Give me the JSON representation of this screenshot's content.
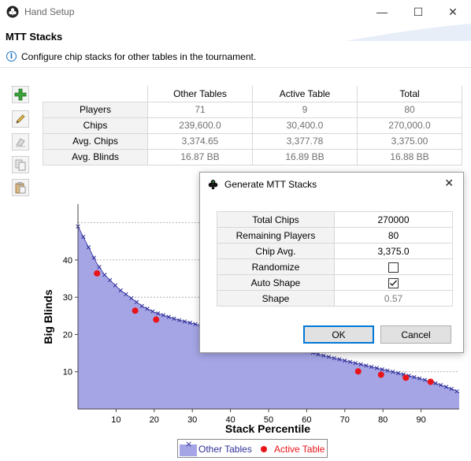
{
  "window": {
    "title": "Hand Setup",
    "minimize_glyph": "—",
    "maximize_glyph": "☐",
    "close_glyph": "✕"
  },
  "header": {
    "title": "MTT Stacks",
    "info_icon_glyph": "i",
    "info_text": "Configure chip stacks for other tables in the tournament."
  },
  "toolbar": {
    "icons": [
      "add-icon",
      "edit-icon",
      "clear-icon",
      "copy-icon",
      "paste-icon"
    ]
  },
  "stats_table": {
    "columns": [
      "Other Tables",
      "Active Table",
      "Total"
    ],
    "rows": [
      {
        "label": "Players",
        "values": [
          "71",
          "9",
          "80"
        ]
      },
      {
        "label": "Chips",
        "values": [
          "239,600.0",
          "30,400.0",
          "270,000.0"
        ]
      },
      {
        "label": "Avg. Chips",
        "values": [
          "3,374.65",
          "3,377.78",
          "3,375.00"
        ]
      },
      {
        "label": "Avg. Blinds",
        "values": [
          "16.87 BB",
          "16.89 BB",
          "16.88 BB"
        ]
      }
    ]
  },
  "chart_data": {
    "type": "area",
    "xlabel": "Stack Percentile",
    "ylabel": "Big Blinds",
    "xlim": [
      0,
      100
    ],
    "ylim": [
      0,
      55
    ],
    "xticks": [
      10,
      20,
      30,
      40,
      50,
      60,
      70,
      80,
      90
    ],
    "yticks": [
      10,
      20,
      30,
      40
    ],
    "grid": "horizontal-dashed",
    "legend_position": "bottom-center",
    "colors": {
      "other_fill": "#a5a5e6",
      "other_marker": "#2f2f9a",
      "active": "#e8141a"
    },
    "series": [
      {
        "name": "Other Tables",
        "style": "area-with-x-markers",
        "x": [
          0,
          1.5,
          3,
          5,
          7,
          9,
          11,
          13,
          15,
          17,
          20,
          23,
          26,
          30,
          35,
          40,
          45,
          50,
          55,
          60,
          65,
          70,
          75,
          80,
          85,
          90,
          93,
          95,
          97,
          99,
          100
        ],
        "y": [
          49,
          46,
          43,
          39,
          36,
          34,
          32,
          30.5,
          29,
          27.5,
          26,
          25,
          24,
          23,
          21.7,
          20.3,
          19.1,
          18,
          16.8,
          15.5,
          14.2,
          13,
          11.8,
          10.6,
          9.4,
          8.1,
          7.2,
          6.5,
          5.8,
          5,
          4.4
        ]
      },
      {
        "name": "Active Table",
        "style": "dots",
        "x": [
          5,
          15,
          20.5,
          73.5,
          79.5,
          86,
          92.5
        ],
        "y": [
          36.4,
          26.4,
          24,
          10.1,
          9.2,
          8.4,
          7.3
        ]
      }
    ]
  },
  "dialog": {
    "title": "Generate MTT Stacks",
    "close_glyph": "✕",
    "fields": [
      {
        "label": "Total Chips",
        "value": "270000"
      },
      {
        "label": "Remaining Players",
        "value": "80"
      },
      {
        "label": "Chip Avg.",
        "value": "3,375.0"
      },
      {
        "label": "Randomize",
        "checked": false
      },
      {
        "label": "Auto Shape",
        "checked": true
      },
      {
        "label": "Shape",
        "value": "0.57"
      }
    ],
    "ok_label": "OK",
    "cancel_label": "Cancel"
  }
}
